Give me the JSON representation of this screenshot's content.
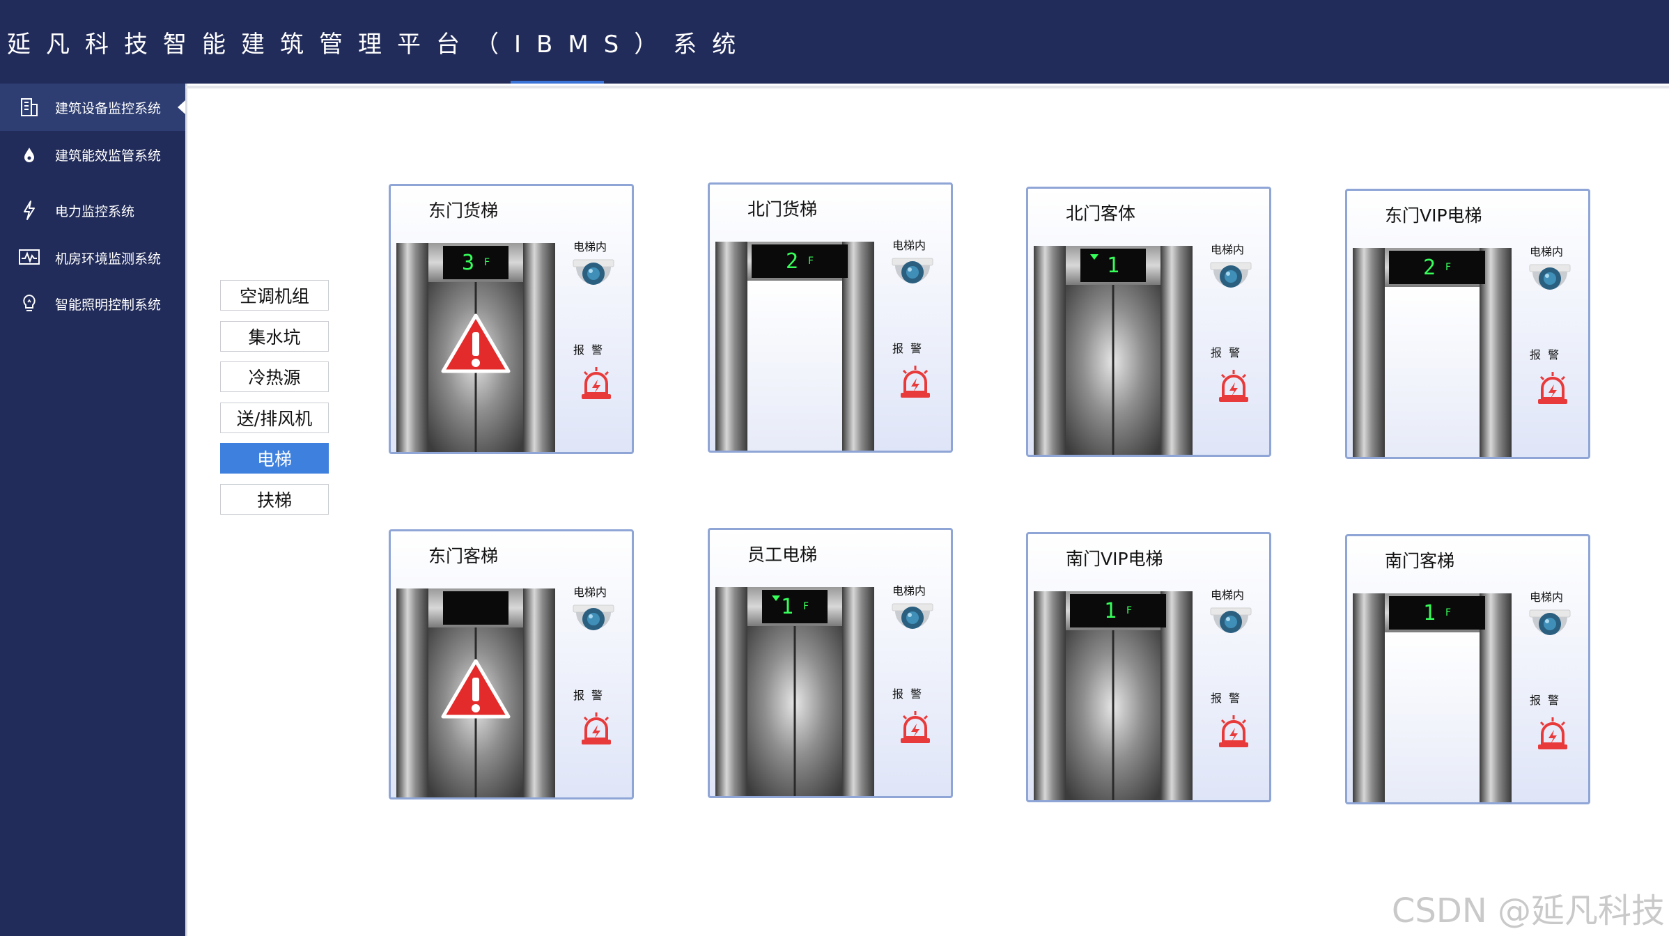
{
  "header": {
    "title": "延凡科技智能建筑管理平台（IBMS）系统"
  },
  "sidebar": {
    "items": [
      {
        "label": "建筑设备监控系统",
        "icon": "building-icon",
        "active": true
      },
      {
        "label": "建筑能效监管系统",
        "icon": "drop-icon",
        "active": false
      },
      {
        "label": "电力监控系统",
        "icon": "lightning-icon",
        "active": false
      },
      {
        "label": "机房环境监测系统",
        "icon": "monitor-wave-icon",
        "active": false
      },
      {
        "label": "智能照明控制系统",
        "icon": "lightbulb-icon",
        "active": false
      }
    ]
  },
  "categories": [
    {
      "label": "空调机组",
      "active": false
    },
    {
      "label": "集水坑",
      "active": false
    },
    {
      "label": "冷热源",
      "active": false
    },
    {
      "label": "送/排风机",
      "active": false
    },
    {
      "label": "电梯",
      "active": true
    },
    {
      "label": "扶梯",
      "active": false
    }
  ],
  "elevator_labels": {
    "camera": "电梯内",
    "alarm": "报警",
    "floor_unit": "F"
  },
  "elevators": [
    {
      "name": "东门货梯",
      "floor": "3",
      "state": "fault",
      "direction": ""
    },
    {
      "name": "北门货梯",
      "floor": "2",
      "state": "open",
      "direction": ""
    },
    {
      "name": "北门客体",
      "floor": "1",
      "state": "closed",
      "direction": "down"
    },
    {
      "name": "东门VIP电梯",
      "floor": "2",
      "state": "open",
      "direction": ""
    },
    {
      "name": "东门客梯",
      "floor": "",
      "state": "fault",
      "direction": ""
    },
    {
      "name": "员工电梯",
      "floor": "1",
      "state": "closed",
      "direction": "down"
    },
    {
      "name": "南门VIP电梯",
      "floor": "1",
      "state": "closed",
      "direction": ""
    },
    {
      "name": "南门客梯",
      "floor": "1",
      "state": "open",
      "direction": ""
    }
  ],
  "watermark": "CSDN @延凡科技",
  "colors": {
    "header_bg": "#222c5a",
    "active_blue": "#3e80dd",
    "card_border": "#8ea5d6",
    "floor_text": "#36ff5a",
    "alarm_red": "#e83a3a",
    "warning_red": "#e32b2b"
  }
}
